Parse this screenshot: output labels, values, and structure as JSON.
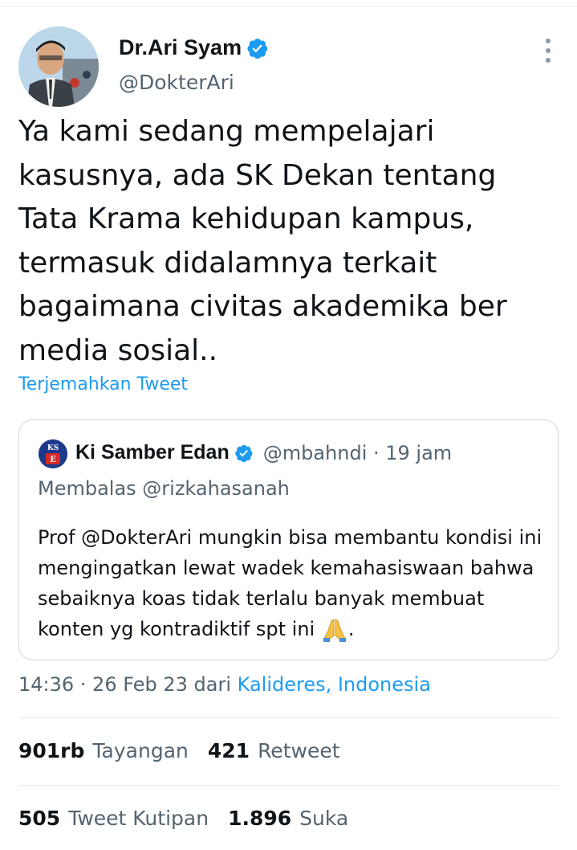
{
  "author": {
    "name": "Dr.Ari Syam",
    "handle": "@DokterAri"
  },
  "tweet": {
    "text": "Ya kami sedang mempelajari kasusnya, ada SK Dekan tentang Tata Krama kehidupan kampus, termasuk didalamnya terkait bagaimana civitas akademika ber media sosial..",
    "translate_label": "Terjemahkan Tweet"
  },
  "quote": {
    "avatar_text_top": "KS",
    "avatar_text_bottom": "E",
    "name": "Ki Samber Edan",
    "handle": "@mbahndi · 19 jam",
    "reply_to": "Membalas @rizkahasanah",
    "text": "Prof @DokterAri mungkin bisa membantu kondisi ini mengingatkan lewat wadek kemahasiswaan bahwa sebaiknya koas tidak terlalu banyak membuat konten yg kontradiktif spt ini",
    "text_suffix": "."
  },
  "meta": {
    "time_date": "14:36 · 26 Feb 23 dari ",
    "location": "Kalideres, Indonesia"
  },
  "stats": {
    "views_count": "901rb",
    "views_label": "Tayangan",
    "retweets_count": "421",
    "retweets_label": "Retweet",
    "quotes_count": "505",
    "quotes_label": "Tweet Kutipan",
    "likes_count": "1.896",
    "likes_label": "Suka"
  },
  "colors": {
    "accent": "#1d9bf0",
    "secondary_text": "#536471",
    "primary_text": "#0f1419",
    "border": "#cfd9de"
  }
}
